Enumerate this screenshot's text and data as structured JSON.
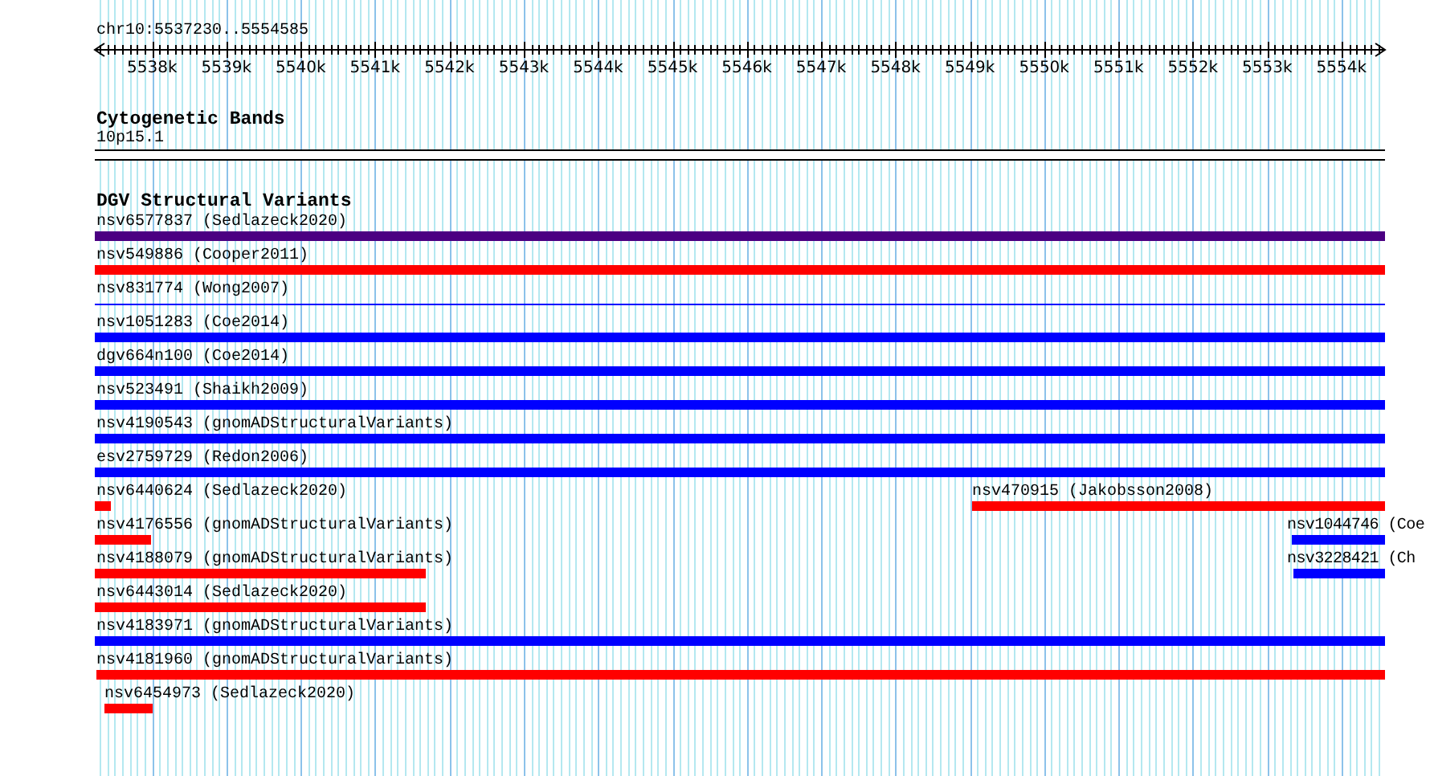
{
  "ruler": {
    "title": "chr10:5537230..5554585",
    "tick_labels": [
      "5538k",
      "5539k",
      "5540k",
      "5541k",
      "5542k",
      "5543k",
      "5544k",
      "5545k",
      "5546k",
      "5547k",
      "5548k",
      "5549k",
      "5550k",
      "5551k",
      "5552k",
      "5553k",
      "5554k"
    ]
  },
  "cytogenetic_bands": {
    "title": "Cytogenetic Bands",
    "bands": [
      {
        "label": "10p15.1"
      }
    ]
  },
  "dgv_track": {
    "title": "DGV Structural Variants",
    "rows": [
      {
        "features": [
          {
            "label": "nsv6577837 (Sedlazeck2020)",
            "kind": "block",
            "color": "#4b0082"
          }
        ]
      },
      {
        "features": [
          {
            "label": "nsv549886 (Cooper2011)",
            "kind": "block",
            "color": "#ff0000"
          }
        ]
      },
      {
        "features": [
          {
            "label": "nsv831774 (Wong2007)",
            "kind": "line",
            "color": "#0000ff"
          }
        ]
      },
      {
        "features": [
          {
            "label": "nsv1051283 (Coe2014)",
            "kind": "block",
            "color": "#0000ff"
          }
        ]
      },
      {
        "features": [
          {
            "label": "dgv664n100 (Coe2014)",
            "kind": "block",
            "color": "#0000ff"
          }
        ]
      },
      {
        "features": [
          {
            "label": "nsv523491 (Shaikh2009)",
            "kind": "block",
            "color": "#0000ff"
          }
        ]
      },
      {
        "features": [
          {
            "label": "nsv4190543 (gnomADStructuralVariants)",
            "kind": "block",
            "color": "#0000ff"
          }
        ]
      },
      {
        "features": [
          {
            "label": "esv2759729 (Redon2006)",
            "kind": "block",
            "color": "#0000ff"
          }
        ]
      },
      {
        "features": [
          {
            "label": "nsv6440624 (Sedlazeck2020)",
            "kind": "block",
            "color": "#ff0000"
          },
          {
            "label": "nsv470915 (Jakobsson2008)",
            "kind": "block",
            "color": "#ff0000"
          }
        ]
      },
      {
        "features": [
          {
            "label": "nsv4176556 (gnomADStructuralVariants)",
            "kind": "block",
            "color": "#ff0000"
          },
          {
            "label": "nsv1044746 (Coe",
            "kind": "block",
            "color": "#0000ff"
          }
        ]
      },
      {
        "features": [
          {
            "label": "nsv4188079 (gnomADStructuralVariants)",
            "kind": "block",
            "color": "#ff0000"
          },
          {
            "label": "nsv3228421 (Ch",
            "kind": "block",
            "color": "#0000ff"
          }
        ]
      },
      {
        "features": [
          {
            "label": "nsv6443014 (Sedlazeck2020)",
            "kind": "block",
            "color": "#ff0000"
          }
        ]
      },
      {
        "features": [
          {
            "label": "nsv4183971 (gnomADStructuralVariants)",
            "kind": "block",
            "color": "#0000ff"
          }
        ]
      },
      {
        "features": [
          {
            "label": "nsv4181960 (gnomADStructuralVariants)",
            "kind": "block",
            "color": "#ff0000"
          }
        ]
      },
      {
        "features": [
          {
            "label": "nsv6454973 (Sedlazeck2020)",
            "kind": "block",
            "color": "#ff0000"
          }
        ]
      }
    ]
  }
}
